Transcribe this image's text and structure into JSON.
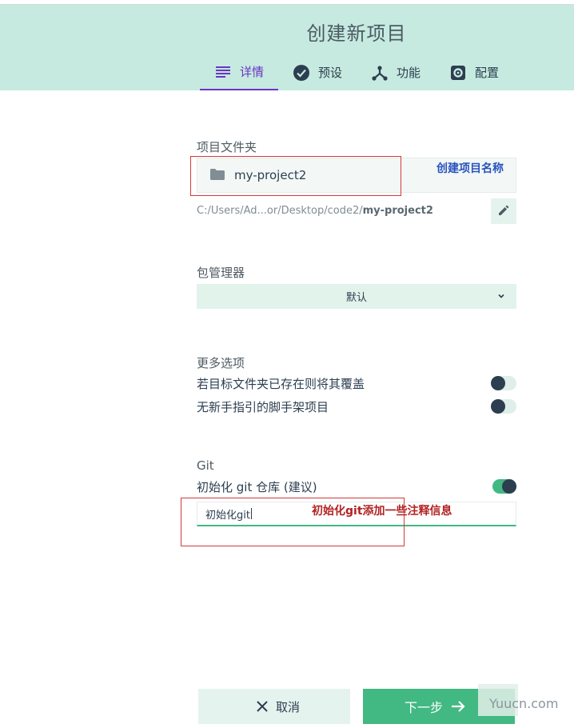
{
  "header": {
    "title": "创建新项目",
    "tabs": [
      {
        "label": "详情",
        "icon": "list-icon",
        "active": true
      },
      {
        "label": "预设",
        "icon": "check-circle-icon"
      },
      {
        "label": "功能",
        "icon": "branch-icon"
      },
      {
        "label": "配置",
        "icon": "gear-icon"
      }
    ]
  },
  "project_folder": {
    "label": "项目文件夹",
    "value": "my-project2",
    "path_prefix": "C:/Users/Ad...or/Desktop/code2/",
    "path_name": "my-project2"
  },
  "package_manager": {
    "label": "包管理器",
    "selected": "默认"
  },
  "more_options": {
    "label": "更多选项",
    "items": [
      {
        "label": "若目标文件夹已存在则将其覆盖",
        "on": false
      },
      {
        "label": "无新手指引的脚手架项目",
        "on": false
      }
    ]
  },
  "git": {
    "label": "Git",
    "init_label": "初始化 git 仓库 (建议)",
    "init_on": true,
    "commit_message": "初始化git"
  },
  "annotations": {
    "project_name_note": "创建项目名称",
    "git_note": "初始化git添加一些注释信息"
  },
  "footer": {
    "cancel_label": "取消",
    "next_label": "下一步"
  },
  "watermark": "Yuucn.com",
  "colors": {
    "header_bg": "#c6eadf",
    "accent_purple": "#6b34c7",
    "green": "#42b883",
    "annotation_blue": "#2a52be",
    "annotation_red": "#b22222"
  }
}
